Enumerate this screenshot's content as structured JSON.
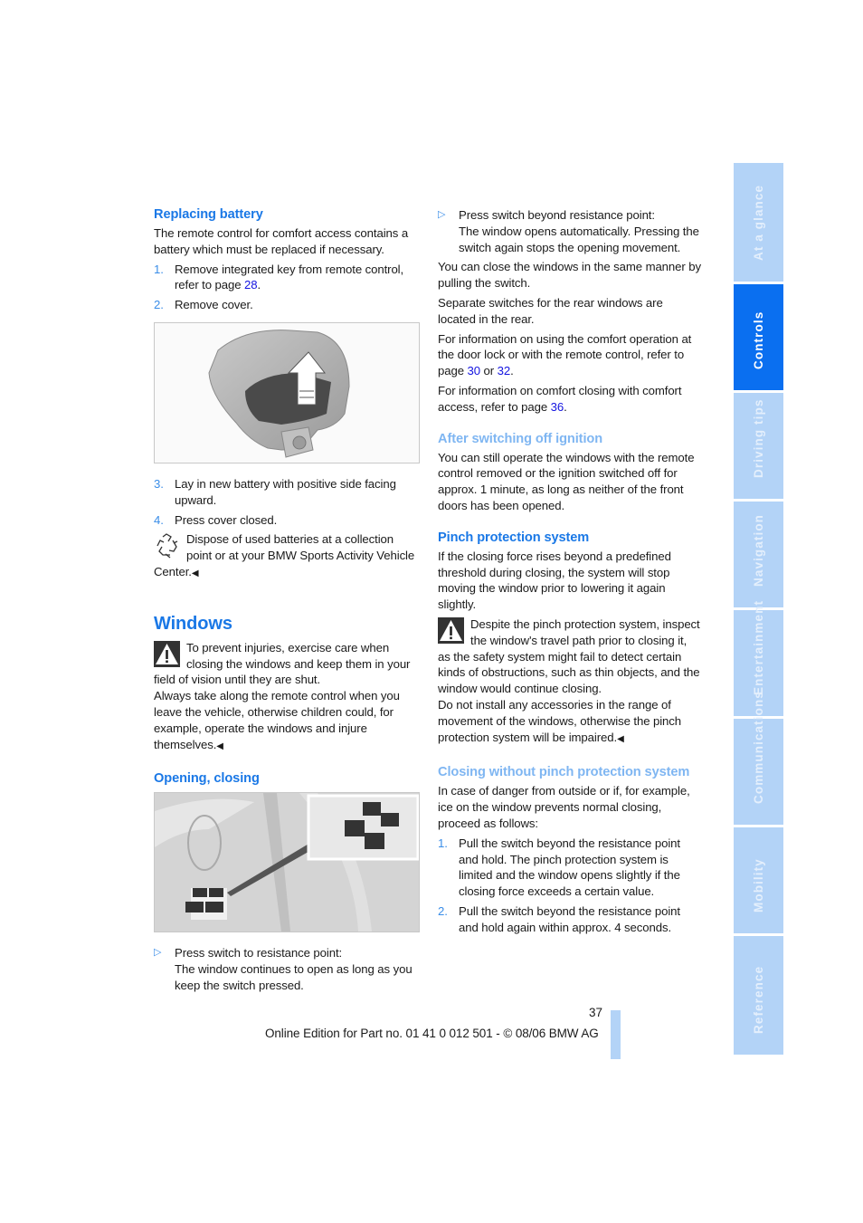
{
  "left_column": {
    "replacing_battery": {
      "heading": "Replacing battery",
      "intro": "The remote control for comfort access contains a battery which must be replaced if necessary.",
      "steps": [
        {
          "num": "1.",
          "text_before": "Remove integrated key from remote control, refer to page ",
          "link": "28",
          "text_after": "."
        },
        {
          "num": "2.",
          "text": "Remove cover."
        },
        {
          "num": "3.",
          "text": "Lay in new battery with positive side facing upward."
        },
        {
          "num": "4.",
          "text": "Press cover closed."
        }
      ],
      "figure_alt": "Remote control with cover being lifted off",
      "figure_code": "W9CH0199",
      "disposal_note": "Dispose of used batteries at a collection point or at your BMW Sports Activity Vehicle Center.",
      "end_mark": "◀"
    },
    "windows": {
      "heading": "Windows",
      "warning_1": "To prevent injuries, exercise care when closing the windows and keep them in your field of vision until they are shut.",
      "warning_2": "Always take along the remote control when you leave the vehicle, otherwise children could, for example, operate the windows and injure themselves.",
      "end_mark": "◀"
    },
    "opening_closing": {
      "heading": "Opening, closing",
      "figure_alt": "Window switches in door panel with magnified inset",
      "figure_code": "W9CH0200",
      "bullet_1_title": "Press switch to resistance point:",
      "bullet_1_text": "The window continues to open as long as you keep the switch pressed."
    }
  },
  "right_column": {
    "bullet_2_title": "Press switch beyond resistance point:",
    "bullet_2_text": "The window opens automatically. Pressing the switch again stops the opening movement.",
    "close_same_manner": "You can close the windows in the same manner by pulling the switch.",
    "rear_switches": "Separate switches for the rear windows are located in the rear.",
    "comfort_info": {
      "before": "For information on using the comfort operation at the door lock or with the remote control, refer to page ",
      "link1": "30",
      "middle": " or ",
      "link2": "32",
      "after": "."
    },
    "comfort_closing_info": {
      "before": "For information on comfort closing with comfort access, refer to page ",
      "link": "36",
      "after": "."
    },
    "after_ignition": {
      "heading": "After switching off ignition",
      "text": "You can still operate the windows with the remote control removed or the ignition switched off for approx. 1 minute, as long as neither of the front doors has been opened."
    },
    "pinch_protection": {
      "heading": "Pinch protection system",
      "text": "If the closing force rises beyond a predefined threshold during closing, the system will stop moving the window prior to lowering it again slightly.",
      "warning_1": "Despite the pinch protection system, inspect the window's travel path prior to closing it, as the safety system might fail to detect certain kinds of obstructions, such as thin objects, and the window would continue closing.",
      "warning_2": "Do not install any accessories in the range of movement of the windows, otherwise the pinch protection system will be impaired.",
      "end_mark": "◀"
    },
    "closing_without_pinch": {
      "heading": "Closing without pinch protection system",
      "intro": "In case of danger from outside or if, for example, ice on the window prevents normal closing, proceed as follows:",
      "steps": [
        {
          "num": "1.",
          "text": "Pull the switch beyond the resistance point and hold. The pinch protection system is limited and the window opens slightly if the closing force exceeds a certain value."
        },
        {
          "num": "2.",
          "text": "Pull the switch beyond the resistance point and hold again within approx. 4 seconds."
        }
      ]
    }
  },
  "side_tabs": [
    {
      "label": "At a glance",
      "active": false
    },
    {
      "label": "Controls",
      "active": true
    },
    {
      "label": "Driving tips",
      "active": false
    },
    {
      "label": "Navigation",
      "active": false
    },
    {
      "label": "Entertainment",
      "active": false
    },
    {
      "label": "Communications",
      "active": false
    },
    {
      "label": "Mobility",
      "active": false
    },
    {
      "label": "Reference",
      "active": false
    }
  ],
  "footer": {
    "page_number": "37",
    "edition_text": "Online Edition for Part no. 01 41 0 012 501 - © 08/06 BMW AG"
  },
  "icons": {
    "bullet": "▷",
    "recycle": "recycle-icon",
    "warning": "warning-icon"
  }
}
